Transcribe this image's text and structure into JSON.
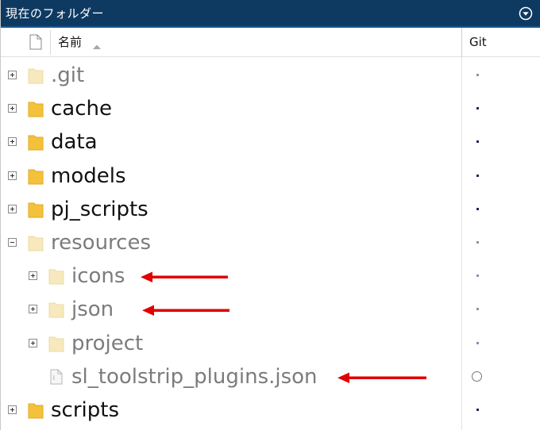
{
  "panel": {
    "title": "現在のフォルダー",
    "menu_icon": "circle-chevron-down-icon"
  },
  "header": {
    "name_label": "名前",
    "sort_indicator": "sort-ascending-icon",
    "git_label": "Git"
  },
  "colors": {
    "titlebar_bg": "#0e3a62",
    "folder_yellow": "#f4c13a",
    "folder_pale": "#f7e9bd",
    "arrow_red": "#e00000"
  },
  "tree": [
    {
      "name": ".git",
      "kind": "folder",
      "depth": 0,
      "expanded": false,
      "dimmed": true,
      "git": "dot-faint"
    },
    {
      "name": "cache",
      "kind": "folder",
      "depth": 0,
      "expanded": false,
      "dimmed": false,
      "git": "dot"
    },
    {
      "name": "data",
      "kind": "folder",
      "depth": 0,
      "expanded": false,
      "dimmed": false,
      "git": "dot"
    },
    {
      "name": "models",
      "kind": "folder",
      "depth": 0,
      "expanded": false,
      "dimmed": false,
      "git": "dot"
    },
    {
      "name": "pj_scripts",
      "kind": "folder",
      "depth": 0,
      "expanded": false,
      "dimmed": false,
      "git": "dot"
    },
    {
      "name": "resources",
      "kind": "folder",
      "depth": 0,
      "expanded": true,
      "dimmed": true,
      "git": "dot-faint"
    },
    {
      "name": "icons",
      "kind": "folder",
      "depth": 1,
      "expanded": false,
      "dimmed": true,
      "git": "dot-faint",
      "annotated": true
    },
    {
      "name": "json",
      "kind": "folder",
      "depth": 1,
      "expanded": false,
      "dimmed": true,
      "git": "dot-faint",
      "annotated": true
    },
    {
      "name": "project",
      "kind": "folder",
      "depth": 1,
      "expanded": false,
      "dimmed": true,
      "git": "dot-faint",
      "annotated": false
    },
    {
      "name": "sl_toolstrip_plugins.json",
      "kind": "file",
      "depth": 1,
      "expanded": null,
      "dimmed": true,
      "git": "circle",
      "annotated": true
    },
    {
      "name": "scripts",
      "kind": "folder",
      "depth": 0,
      "expanded": false,
      "dimmed": false,
      "git": "dot"
    }
  ]
}
